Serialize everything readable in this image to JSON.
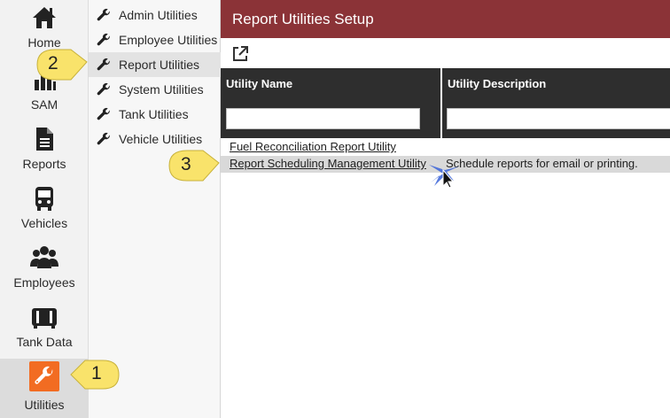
{
  "rail": {
    "items": [
      {
        "label": "Home",
        "icon": "home-icon"
      },
      {
        "label": "SAM",
        "icon": "bar-chart-icon"
      },
      {
        "label": "Reports",
        "icon": "document-icon"
      },
      {
        "label": "Vehicles",
        "icon": "bus-icon"
      },
      {
        "label": "Employees",
        "icon": "users-icon"
      },
      {
        "label": "Tank Data",
        "icon": "tank-icon"
      },
      {
        "label": "Utilities",
        "icon": "wrench-icon",
        "active": true
      }
    ],
    "active_color": "#f26c22"
  },
  "submenu": {
    "items": [
      {
        "label": "Admin Utilities"
      },
      {
        "label": "Employee Utilities"
      },
      {
        "label": "Report Utilities",
        "active": true
      },
      {
        "label": "System Utilities"
      },
      {
        "label": "Tank Utilities"
      },
      {
        "label": "Vehicle Utilities"
      }
    ]
  },
  "main": {
    "title": "Report Utilities Setup",
    "title_bar_color": "#8b3337",
    "toolbar": {
      "export_icon": "external-link-icon"
    },
    "grid": {
      "columns": [
        "Utility Name",
        "Utility Description"
      ],
      "filters": {
        "name_value": "",
        "description_value": ""
      },
      "rows": [
        {
          "name": "Fuel Reconciliation Report Utility",
          "description": ""
        },
        {
          "name": "Report Scheduling Management Utility",
          "description": "Schedule reports for email or printing."
        }
      ]
    }
  },
  "callouts": {
    "one": "1",
    "two": "2",
    "three": "3",
    "color": "#f9e36b"
  }
}
